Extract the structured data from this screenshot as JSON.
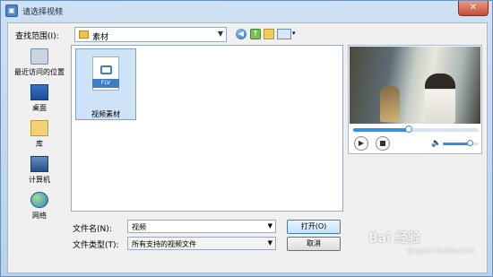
{
  "window": {
    "title": "请选择视频",
    "app_icon": "video-select-icon"
  },
  "toolbar": {
    "look_in_label": "查找范围(I):",
    "look_in_value": "素材",
    "back_icon": "back-icon",
    "up_icon": "up-folder-icon",
    "new_folder_icon": "new-folder-icon",
    "view_icon": "view-menu-icon",
    "view_arrow": "▾"
  },
  "places": [
    {
      "label": "最近访问的位置",
      "icon": "recent-places-icon"
    },
    {
      "label": "桌面",
      "icon": "desktop-icon"
    },
    {
      "label": "库",
      "icon": "library-icon"
    },
    {
      "label": "计算机",
      "icon": "computer-icon"
    },
    {
      "label": "网络",
      "icon": "network-icon"
    }
  ],
  "files": [
    {
      "name": "视频素材",
      "badge": "FLV",
      "icon": "flv-file-icon"
    }
  ],
  "form": {
    "filename_label": "文件名(N):",
    "filename_value": "视频",
    "filetype_label": "文件类型(T):",
    "filetype_value": "所有支持的视频文件"
  },
  "buttons": {
    "open": "打开(O)",
    "cancel": "取消",
    "close": "✕"
  },
  "preview": {
    "seek_progress": 0.44,
    "volume": 0.75,
    "play_glyph": "▶",
    "volume_glyph": "🔈"
  },
  "watermark": {
    "main": "Bai 经验",
    "sub": "jingyan.baidu.com"
  },
  "colors": {
    "accent": "#3a8fe0",
    "title_bar": "#c6dbf1"
  }
}
